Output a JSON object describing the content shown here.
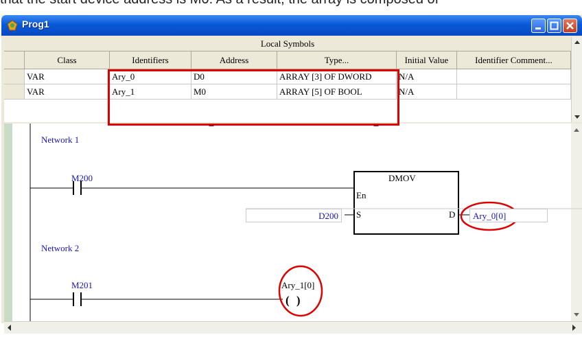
{
  "caption": "that the start device address is M0. As a result, the array is composed of",
  "window": {
    "title": "Prog1"
  },
  "symbols": {
    "title": "Local Symbols",
    "columns": [
      "Class",
      "Identifiers",
      "Address",
      "Type...",
      "Initial Value",
      "Identifier Comment..."
    ],
    "rows": [
      [
        "VAR",
        "Ary_0",
        "D0",
        "ARRAY [3] OF DWORD",
        "N/A",
        ""
      ],
      [
        "VAR",
        "Ary_1",
        "M0",
        "ARRAY [5] OF BOOL",
        "N/A",
        ""
      ]
    ]
  },
  "ladder": {
    "network1": "Network 1",
    "network2": "Network 2",
    "contact1": "M200",
    "contact2": "M201",
    "block_name": "DMOV",
    "en": "En",
    "s": "S",
    "d": "D",
    "source": "D200",
    "dest": "Ary_0[0]",
    "coil": "Ary_1[0]",
    "coil_symbol": "( )"
  },
  "colors": {
    "highlight": "#e00000",
    "device_text": "#1414c8",
    "title_bar": "#0a59d8"
  }
}
